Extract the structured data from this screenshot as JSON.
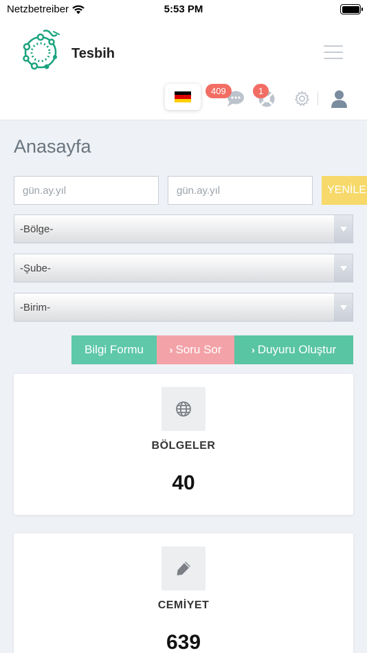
{
  "status_bar": {
    "carrier": "Netzbetreiber",
    "time": "5:53 PM"
  },
  "header": {
    "brand": "Tesbih",
    "messages_badge": "409",
    "notifications_badge": "1"
  },
  "page": {
    "title": "Anasayfa"
  },
  "filters": {
    "start_date": {
      "value": "",
      "placeholder": "gün.ay.yıl"
    },
    "end_date": {
      "value": "",
      "placeholder": "gün.ay.yıl"
    },
    "refresh_label": "YENİLE",
    "region_select": "-Bölge-",
    "branch_select": "-Şube-",
    "unit_select": "-Birim-"
  },
  "actions": {
    "info_form": "Bilgi Formu",
    "ask_question": "Soru Sor",
    "create_announcement": "Duyuru Oluştur"
  },
  "cards": [
    {
      "icon": "globe-icon",
      "label": "BÖLGELER",
      "value": "40"
    },
    {
      "icon": "pencil-icon",
      "label": "CEMİYET",
      "value": "639"
    }
  ],
  "colors": {
    "brand_green": "#1aa37e",
    "badge_red": "#f26d63",
    "refresh_yellow": "#f6d96a",
    "info_teal": "#5ec8a8",
    "ask_pink": "#f3a3a8",
    "announce_teal": "#59c5a2",
    "icon_gray": "#bcc3cc"
  }
}
